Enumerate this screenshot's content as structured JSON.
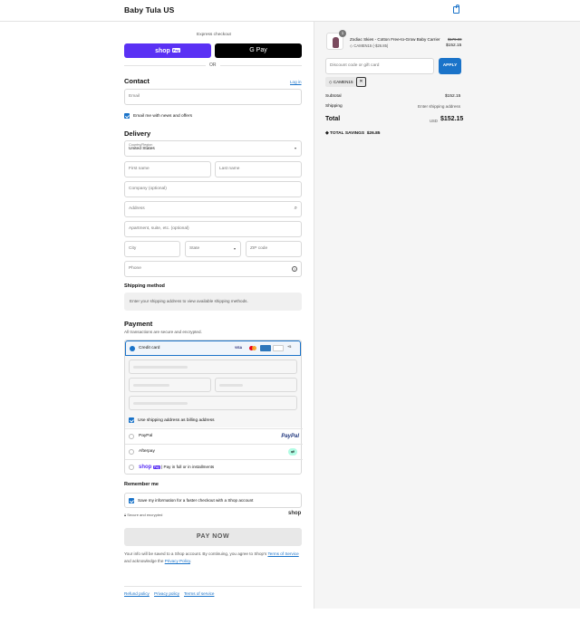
{
  "header": {
    "brand": "Baby Tula US",
    "cart_icon": "shopping-bag-icon"
  },
  "express": {
    "label": "Express checkout",
    "shop_pay": "shop",
    "shop_pay_badge": "Pay",
    "gpay": "G Pay",
    "or": "OR"
  },
  "contact": {
    "title": "Contact",
    "login": "Log in",
    "email_placeholder": "Email",
    "newsletter": "Email me with news and offers"
  },
  "delivery": {
    "title": "Delivery",
    "country_label": "Country/Region",
    "country_value": "United States",
    "first_name": "First name",
    "last_name": "Last name",
    "company": "Company (optional)",
    "address": "Address",
    "apartment": "Apartment, suite, etc. (optional)",
    "city": "City",
    "state": "State",
    "zip": "ZIP code",
    "phone": "Phone"
  },
  "shipping_method": {
    "title": "Shipping method",
    "note": "Enter your shipping address to view available shipping methods."
  },
  "payment": {
    "title": "Payment",
    "subtitle": "All transactions are secure and encrypted.",
    "credit_card": "Credit card",
    "cards": [
      "VISA",
      "MC",
      "AMEX",
      "DISC",
      "+5"
    ],
    "billing": "Use shipping address as billing address",
    "paypal": "PayPal",
    "paypal_logo": "PayPal",
    "afterpay": "Afterpay",
    "shoppay_logo": "shop",
    "shoppay_badge": "Pay",
    "shoppay_text": "| Pay in full or in installments"
  },
  "remember": {
    "title": "Remember me",
    "save_info": "Save my information for a faster checkout with a Shop account",
    "secure": "Secure and encrypted",
    "shop_logo": "shop"
  },
  "pay_now": "PAY NOW",
  "legal": {
    "pre": "Your info will be saved to a Shop account. By continuing, you agree to Shop's",
    "tos": "Terms of Service",
    "mid": "and acknowledge the",
    "privacy": "Privacy Policy",
    "end": "."
  },
  "footer": {
    "refund": "Refund policy",
    "privacy": "Privacy policy",
    "terms": "Terms of service"
  },
  "summary": {
    "item_qty": "1",
    "item_name": "Zodiac Skies - Cotton Free-to-Grow Baby Carrier",
    "item_discount": "CAMEN15 (-$26.85)",
    "price_original": "$179.00",
    "price_now": "$152.15",
    "discount_placeholder": "Discount code or gift card",
    "apply": "APPLY",
    "code_chip": "CAMEN15",
    "subtotal_label": "Subtotal",
    "subtotal_value": "$152.15",
    "shipping_label": "Shipping",
    "shipping_value": "Enter shipping address",
    "total_label": "Total",
    "currency": "USD",
    "total_value": "$152.15",
    "savings_label": "TOTAL SAVINGS",
    "savings_value": "$26.85"
  },
  "colors": {
    "accent": "#1a73c9",
    "shop_purple": "#5a31f4"
  }
}
